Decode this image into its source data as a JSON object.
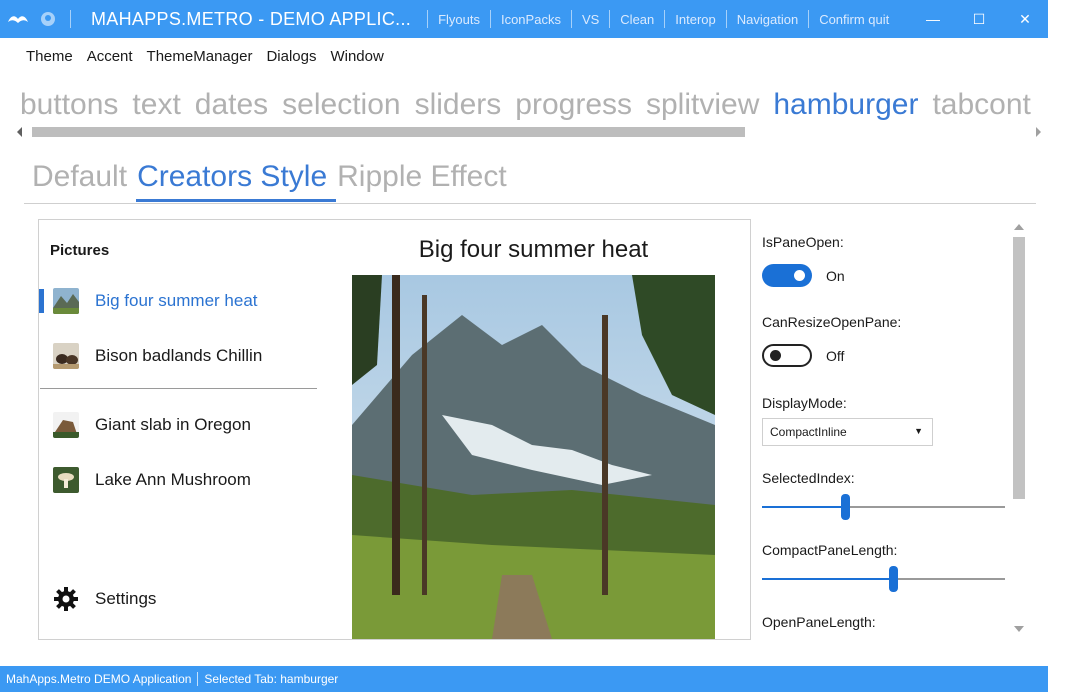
{
  "titlebar": {
    "title": "MAHAPPS.METRO - DEMO APPLIC...",
    "commands": [
      "Flyouts",
      "IconPacks",
      "VS",
      "Clean",
      "Interop",
      "Navigation",
      "Confirm quit"
    ],
    "minimize_glyph": "—",
    "maximize_glyph": "☐",
    "close_glyph": "✕"
  },
  "menu": [
    "Theme",
    "Accent",
    "ThemeManager",
    "Dialogs",
    "Window"
  ],
  "main_tabs": [
    "buttons",
    "text",
    "dates",
    "selection",
    "sliders",
    "progress",
    "splitview",
    "hamburger",
    "tabcont"
  ],
  "main_tabs_active_index": 7,
  "sub_tabs": [
    "Default",
    "Creators Style",
    "Ripple Effect"
  ],
  "sub_tabs_active_index": 1,
  "hamburger": {
    "pane_header": "Pictures",
    "items": [
      {
        "label": "Big four summer heat",
        "selected": true,
        "icon": "mountain-thumbnail"
      },
      {
        "label": "Bison badlands Chillin",
        "selected": false,
        "icon": "bison-thumbnail"
      },
      {
        "label": "Giant slab in Oregon",
        "selected": false,
        "icon": "rock-thumbnail"
      },
      {
        "label": "Lake Ann Mushroom",
        "selected": false,
        "icon": "mushroom-thumbnail"
      }
    ],
    "settings_label": "Settings",
    "picture_title": "Big four summer heat"
  },
  "properties": {
    "is_pane_open_label": "IsPaneOpen:",
    "is_pane_open_state": "On",
    "can_resize_label": "CanResizeOpenPane:",
    "can_resize_state": "Off",
    "display_mode_label": "DisplayMode:",
    "display_mode_value": "CompactInline",
    "selected_index_label": "SelectedIndex:",
    "selected_index_value": 0.34,
    "compact_pane_length_label": "CompactPaneLength:",
    "compact_pane_length_value": 0.54,
    "open_pane_length_label": "OpenPaneLength:"
  },
  "statusbar": {
    "app": "MahApps.Metro DEMO Application",
    "selected_tab": "Selected Tab:  hamburger"
  },
  "colors": {
    "accent": "#3b99f3",
    "selected": "#2b73d1",
    "toggle_on": "#1a70d6"
  }
}
